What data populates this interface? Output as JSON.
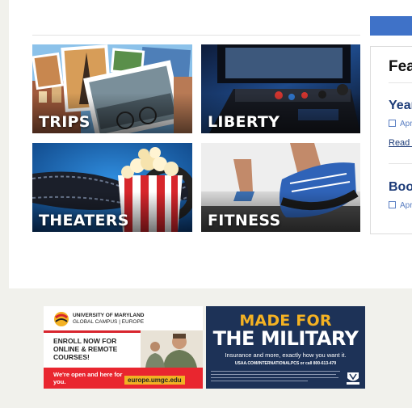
{
  "tiles": [
    {
      "label": "TRIPS"
    },
    {
      "label": "LIBERTY"
    },
    {
      "label": "THEATERS"
    },
    {
      "label": "FITNESS"
    }
  ],
  "featured": {
    "title": "Featured",
    "items": [
      {
        "headline": "Year",
        "date": "Apr",
        "link": "Read M"
      },
      {
        "headline": "Boot",
        "date": "Apr"
      }
    ]
  },
  "ads": {
    "umgc": {
      "name_line1": "UNIVERSITY OF MARYLAND",
      "name_line2": "GLOBAL CAMPUS | EUROPE",
      "cta": "ENROLL NOW FOR ONLINE & REMOTE COURSES!",
      "open": "We're open and here for you.",
      "url": "europe.umgc.edu"
    },
    "usaa": {
      "headline1": "MADE FOR",
      "headline2": "THE MILITARY",
      "subline": "Insurance and more, exactly how you want it.",
      "contact": "USAA.COM/INTERNATIONALPCS or call 800-613-479",
      "logo": "USAA"
    }
  },
  "colors": {
    "accent_blue": "#3f72c8",
    "link_navy": "#1c3b78",
    "usaa_navy": "#1d3257",
    "usaa_gold": "#f4b223",
    "umgc_red": "#e9262f"
  }
}
